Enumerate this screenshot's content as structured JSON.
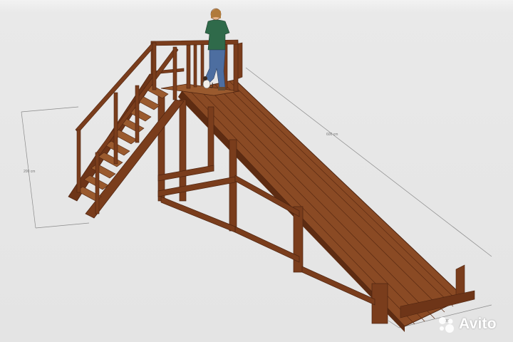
{
  "dimensions": {
    "height_label": "200 cm",
    "length_label": "600 cm",
    "width_label": "120"
  },
  "watermark": {
    "text": "Avito"
  },
  "colors": {
    "background": "#e6e6e6",
    "wood": "#7a3d1c",
    "wood_dark": "#4e2410",
    "dimension_line": "#8a8a8a"
  }
}
